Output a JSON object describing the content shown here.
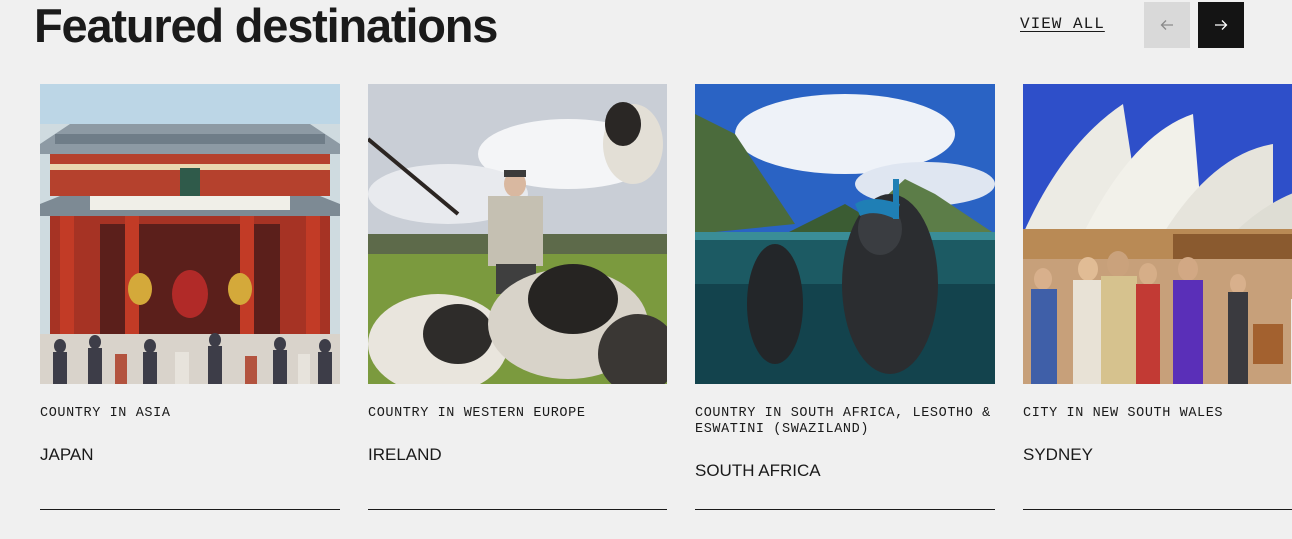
{
  "section": {
    "title": "Featured destinations",
    "view_all_label": "VIEW ALL",
    "prev_icon": "arrow-left-icon",
    "next_icon": "arrow-right-icon"
  },
  "destinations": [
    {
      "category": "COUNTRY IN ASIA",
      "name": "JAPAN",
      "image": "temple-gate-crowd-photo"
    },
    {
      "category": "COUNTRY IN WESTERN EUROPE",
      "name": "IRELAND",
      "image": "farmer-with-sheep-photo"
    },
    {
      "category": "COUNTRY IN SOUTH AFRICA, LESOTHO & ESWATINI (SWAZILAND)",
      "name": "SOUTH AFRICA",
      "image": "snorkeler-mountain-photo"
    },
    {
      "category": "CITY IN NEW SOUTH WALES",
      "name": "SYDNEY",
      "image": "opera-house-crowd-photo"
    }
  ],
  "colors": {
    "background": "#f0f0f0",
    "text": "#1a1a1a",
    "prev_button": "#d9d9d9",
    "next_button": "#141414"
  }
}
